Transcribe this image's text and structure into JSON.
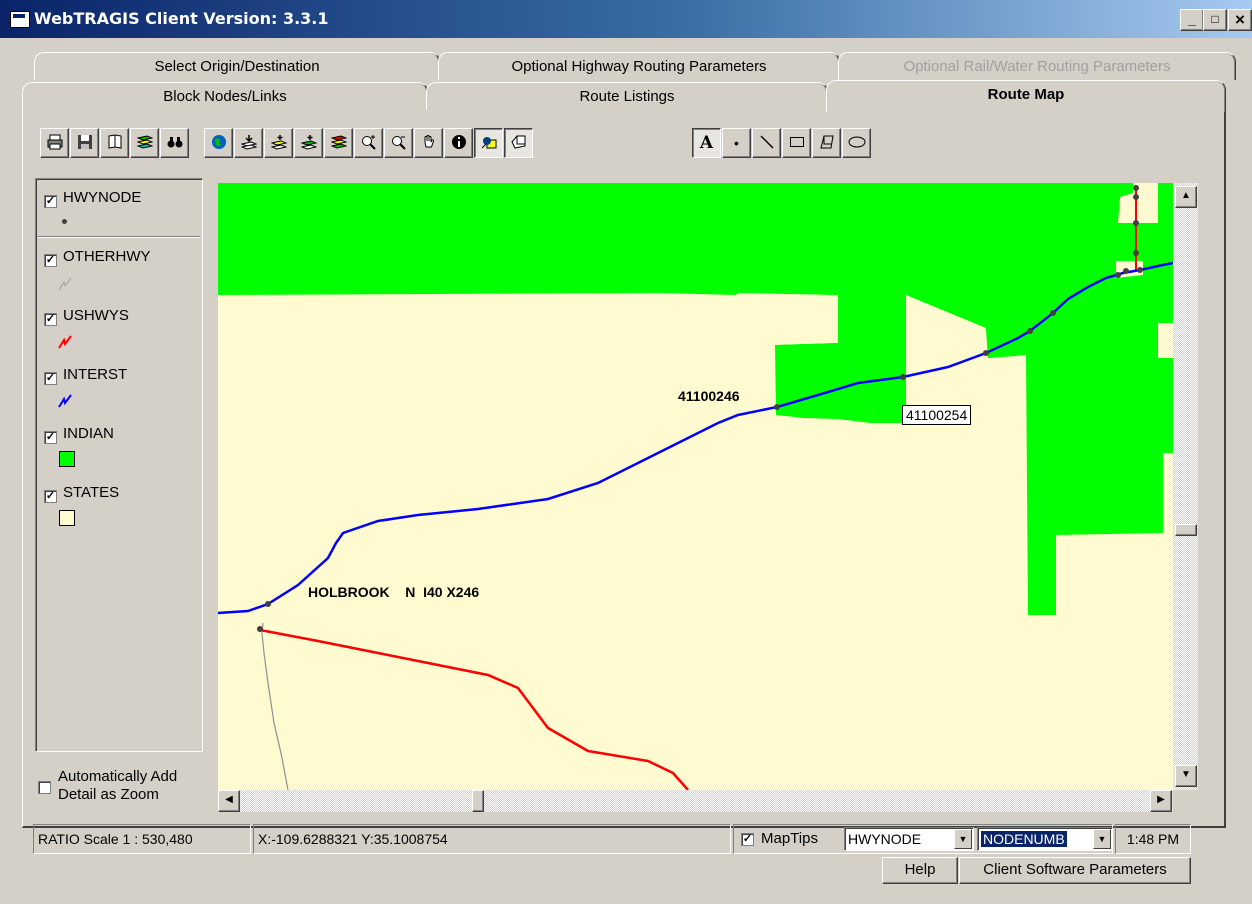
{
  "window": {
    "title": "WebTRAGIS Client Version: 3.3.1",
    "minimize": "_",
    "maximize": "□",
    "close": "×"
  },
  "tabs": {
    "row1": [
      "Select Origin/Destination",
      "Optional Highway Routing Parameters",
      "Optional Rail/Water Routing Parameters"
    ],
    "row2": [
      "Block Nodes/Links",
      "Route Listings",
      "Route Map"
    ],
    "active": "Route Map"
  },
  "toolbar": {
    "map_tools": [
      "print-icon",
      "save-icon",
      "open-map-icon",
      "layers-icon",
      "find-icon",
      "globe-icon",
      "load-layer-icon",
      "add-layer-icon",
      "edit-layer-icon",
      "remove-layer-icon",
      "zoom-in-icon",
      "zoom-out-icon",
      "pan-icon",
      "info-icon",
      "select-icon",
      "polygon-select-icon"
    ],
    "draw_tools": [
      "text-icon",
      "point-icon",
      "line-icon",
      "rectangle-icon",
      "polygon-icon",
      "ellipse-icon"
    ],
    "text_glyph": "A",
    "point_glyph": "•"
  },
  "legend": {
    "layers": [
      {
        "name": "HWYNODE",
        "checked": true,
        "symbol": "dot",
        "color": "#404040"
      },
      {
        "name": "OTHERHWY",
        "checked": true,
        "symbol": "line",
        "color": "#a0a0a0"
      },
      {
        "name": "USHWYS",
        "checked": true,
        "symbol": "line",
        "color": "#ff0000"
      },
      {
        "name": "INTERST",
        "checked": true,
        "symbol": "line",
        "color": "#0000ff"
      },
      {
        "name": "INDIAN",
        "checked": true,
        "symbol": "box",
        "color": "#00ff00"
      },
      {
        "name": "STATES",
        "checked": true,
        "symbol": "box",
        "color": "#fffad0"
      }
    ],
    "auto_detail_label": "Automatically Add Detail as Zoom",
    "auto_detail_checked": false
  },
  "map": {
    "labels": {
      "node1": "41100246",
      "node2": "41100254",
      "holbrook": "HOLBROOK    N  I40 X246"
    },
    "colors": {
      "indian": "#00ff00",
      "states": "#fffad0",
      "interstate": "#0000ff",
      "ushwy": "#ff0000",
      "otherhwy": "#909090"
    }
  },
  "status": {
    "scale": "RATIO Scale 1 : 530,480",
    "coords": "X:-109.6288321   Y:35.1008754",
    "maptips_label": "MapTips",
    "maptips_checked": true,
    "layer_select": "HWYNODE",
    "field_select": "NODENUMB",
    "time": "1:48 PM"
  },
  "buttons": {
    "help": "Help",
    "client_params": "Client Software Parameters"
  }
}
